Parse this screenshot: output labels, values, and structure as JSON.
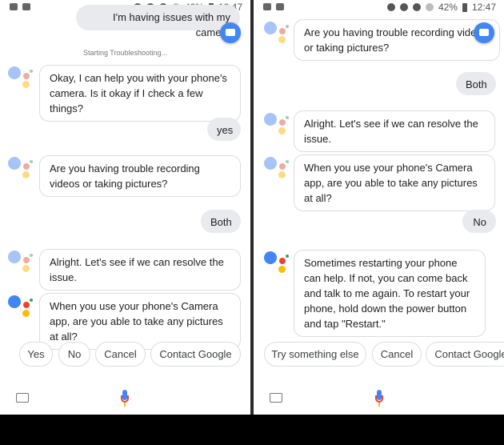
{
  "status_bar": {
    "battery": "42%",
    "time": "12:47"
  },
  "left": {
    "user_message_top": "I'm having issues with my camera",
    "system_note": "Starting Troubleshooting...",
    "messages": [
      {
        "from": "assistant",
        "text": "Okay, I can help you with your phone's camera. Is it okay if I check a few things?"
      },
      {
        "from": "user",
        "text": "yes"
      },
      {
        "from": "assistant",
        "text": "Are you having trouble recording videos or taking pictures?"
      },
      {
        "from": "user",
        "text": "Both"
      },
      {
        "from": "assistant",
        "text": "Alright. Let's see if we can resolve the issue."
      },
      {
        "from": "assistant",
        "text": "When you use your phone's Camera app, are you able to take any pictures at all?"
      }
    ],
    "chips": [
      "Yes",
      "No",
      "Cancel",
      "Contact Google"
    ]
  },
  "right": {
    "messages": [
      {
        "from": "assistant",
        "text": "Are you having trouble recording videos or taking pictures?"
      },
      {
        "from": "user",
        "text": "Both"
      },
      {
        "from": "assistant",
        "text": "Alright. Let's see if we can resolve the issue."
      },
      {
        "from": "assistant",
        "text": "When you use your phone's Camera app, are you able to take any pictures at all?"
      },
      {
        "from": "user",
        "text": "No"
      },
      {
        "from": "assistant",
        "text": "Sometimes restarting your phone can help. If not, you can come back and talk to me again. To restart your phone, hold down the power button and tap \"Restart.\""
      }
    ],
    "chips": [
      "Try something else",
      "Cancel",
      "Contact Google"
    ]
  },
  "colors": {
    "blue": "#4285f4",
    "red": "#ea4335",
    "yellow": "#fbbc04",
    "green": "#34a853"
  },
  "icons": [
    "image-icon",
    "youtube-icon",
    "location-icon",
    "dnd-icon",
    "wifi-icon",
    "no-sim-icon",
    "battery-icon",
    "keyboard-icon",
    "mic-icon",
    "assistant-logo-icon"
  ]
}
